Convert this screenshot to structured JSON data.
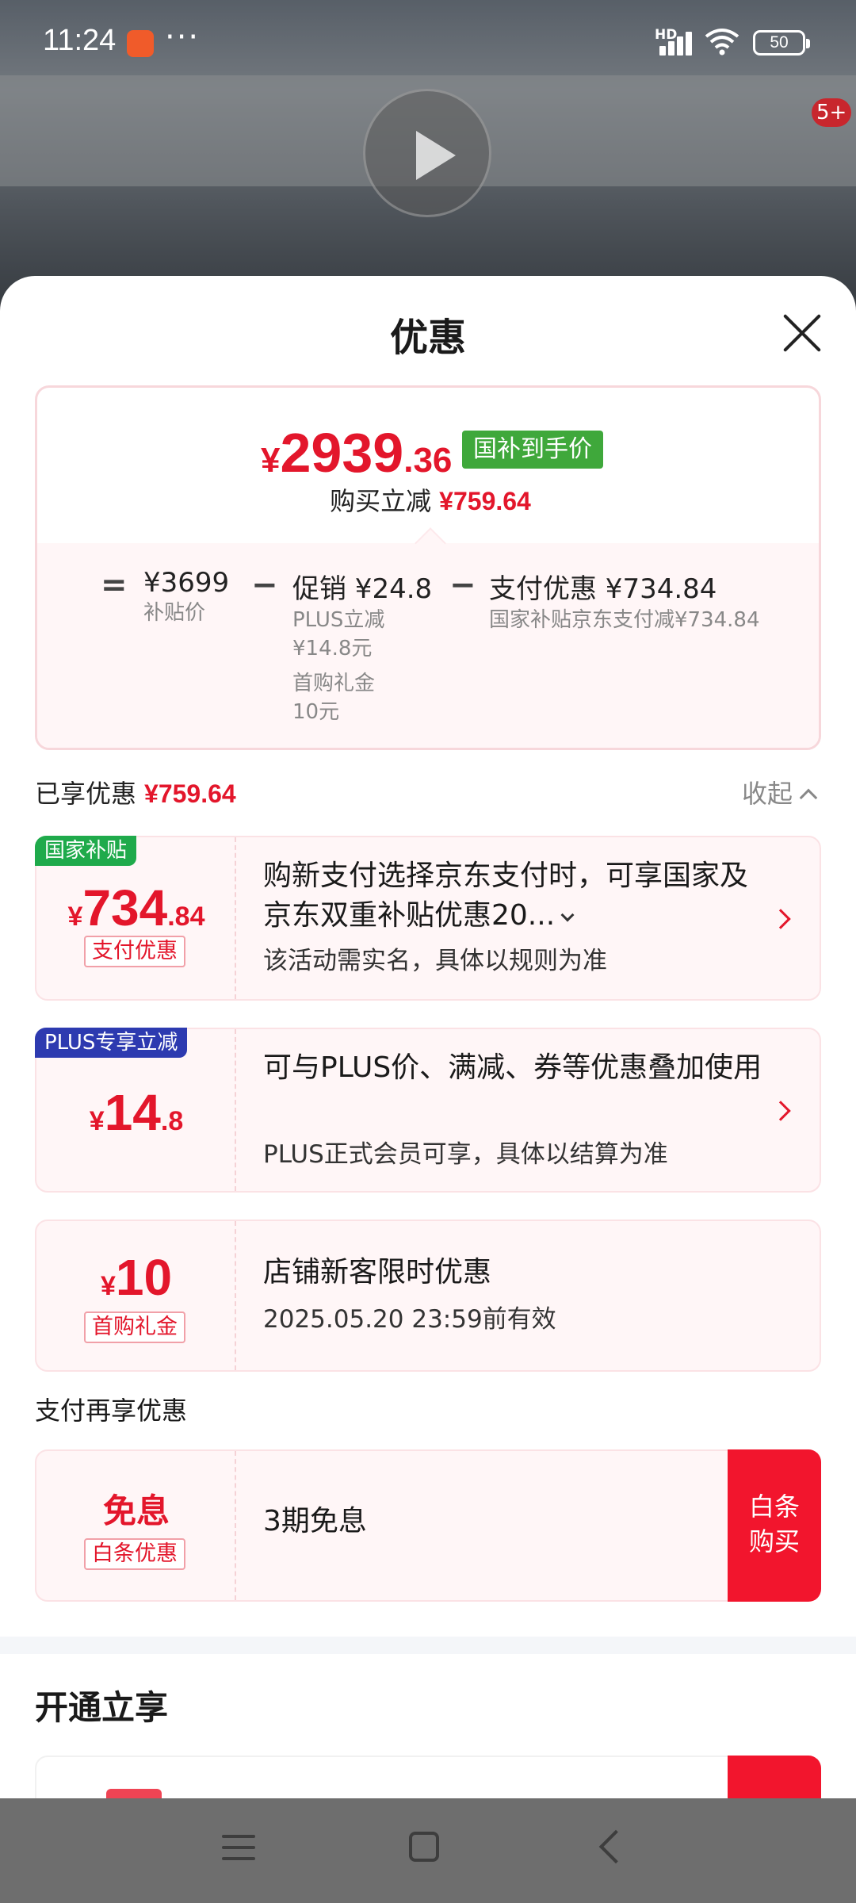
{
  "status_bar": {
    "time": "11:24",
    "more": "···",
    "network": "HD",
    "battery": "50"
  },
  "background": {
    "message_badge": "5+"
  },
  "sheet": {
    "title": "优惠",
    "summary": {
      "price_symbol": "¥",
      "price_int": "2939",
      "price_dec": ".36",
      "price_tag": "国补到手价",
      "reduce_label": "购买立减",
      "reduce_value": "¥759.64",
      "eq": "=",
      "minus": "−",
      "base_price": "¥3699",
      "base_label": "补贴价",
      "promo_title": "促销 ¥24.8",
      "promo_sub1": "PLUS立减",
      "promo_sub2": "¥14.8元",
      "promo_sub3": "首购礼金",
      "promo_sub4": "10元",
      "pay_title": "支付优惠 ¥734.84",
      "pay_sub": "国家补贴京东支付减¥734.84"
    },
    "enjoyed_label": "已享优惠",
    "enjoyed_value": "¥759.64",
    "collapse_label": "收起",
    "coupons": [
      {
        "tag": "国家补贴",
        "symbol": "¥",
        "int": "734",
        "dec": ".84",
        "badge": "支付优惠",
        "desc": "购新支付选择京东支付时，可享国家及京东双重补贴优惠20...",
        "note": "该活动需实名，具体以规则为准"
      },
      {
        "tag": "PLUS专享立减",
        "symbol": "¥",
        "int": "14",
        "dec": ".8",
        "desc": "可与PLUS价、满减、券等优惠叠加使用",
        "note": "PLUS正式会员可享，具体以结算为准"
      },
      {
        "symbol": "¥",
        "int": "10",
        "dec": "",
        "badge": "首购礼金",
        "desc": "店铺新客限时优惠",
        "note": "2025.05.20 23:59前有效"
      }
    ],
    "pay_more_label": "支付再享优惠",
    "baitiao": {
      "title": "免息",
      "badge": "白条优惠",
      "desc": "3期免息",
      "button_line1": "白条",
      "button_line2": "购买"
    },
    "open_title": "开通立享"
  },
  "colors": {
    "accent_red": "#e3162b",
    "subsidy_green": "#3fa83b",
    "plus_blue": "#2d3ab0"
  }
}
